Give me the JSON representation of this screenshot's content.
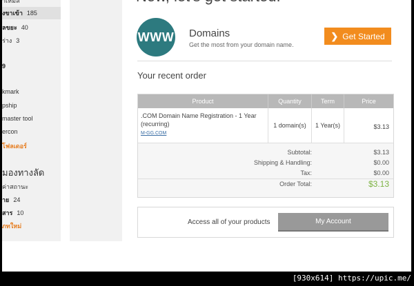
{
  "sidebar": {
    "top_cut": "าเหมล",
    "items": [
      {
        "label": "งขาเข้า",
        "count": "185",
        "bold": true,
        "active": true
      },
      {
        "label": "ลขยะ",
        "count": "40",
        "bold": true
      },
      {
        "label": "ร่าง",
        "count": "3"
      },
      {
        "label": "9",
        "count": "",
        "bold": true
      },
      {
        "label": "kmark",
        "count": ""
      },
      {
        "label": "pship",
        "count": ""
      },
      {
        "label": "master tool",
        "count": ""
      },
      {
        "label": "ercon",
        "count": ""
      },
      {
        "label": "โฟลเดอร์",
        "count": "",
        "orange": true
      },
      {
        "label": "ค่าสถานะ",
        "count": ""
      },
      {
        "label": "าย",
        "count": "24",
        "bold": true
      },
      {
        "label": "สาร",
        "count": "10",
        "bold": true
      },
      {
        "label": "ภทใหม่",
        "count": "",
        "orange": true
      }
    ],
    "heading": "มองทางลัด"
  },
  "main": {
    "heading_cut": "Now, let's get started.",
    "domains": {
      "logo_text": "WWW",
      "title": "Domains",
      "subtitle": "Get the most from your domain name.",
      "button_label": "Get Started",
      "button_icon": "chevron-right-icon"
    },
    "recent_title": "Your recent order",
    "order": {
      "columns": [
        "Product",
        "Quantity",
        "Term",
        "Price"
      ],
      "rows": [
        {
          "product": ".COM Domain Name Registration - 1 Year (recurring)",
          "link": "M-GG.COM",
          "quantity": "1 domain(s)",
          "term": "1 Year(s)",
          "price": "$3.13"
        }
      ],
      "summary": {
        "subtotal_label": "Subtotal:",
        "subtotal": "$3.13",
        "shipping_label": "Shipping & Handling:",
        "shipping": "$0.00",
        "tax_label": "Tax:",
        "tax": "$0.00",
        "total_label": "Order Total:",
        "total": "$3.13"
      }
    },
    "access": {
      "text": "Access all of your products",
      "button_label": "My Account"
    }
  },
  "footer": {
    "text": "[930x614] https://upic.me/"
  },
  "colors": {
    "accent_orange": "#f28c1e",
    "logo_teal": "#2d7a7f",
    "total_green": "#7cb342",
    "header_gray": "#b8b8b8"
  }
}
